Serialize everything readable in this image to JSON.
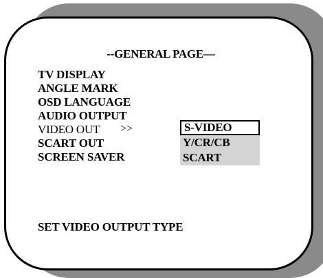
{
  "page": {
    "title": "--GENERAL PAGE—"
  },
  "menu": {
    "items": [
      {
        "label": "TV DISPLAY"
      },
      {
        "label": "ANGLE MARK"
      },
      {
        "label": "OSD LANGUAGE"
      },
      {
        "label": "AUDIO OUTPUT"
      },
      {
        "label": "VIDEO OUT"
      },
      {
        "label": "SCART OUT"
      },
      {
        "label": "SCREEN SAVER"
      }
    ],
    "selected_index": 4,
    "submenu_arrow": ">>"
  },
  "submenu": {
    "options": [
      {
        "label": "S-VIDEO"
      },
      {
        "label": "Y/CR/CB"
      },
      {
        "label": "SCART"
      }
    ],
    "active_index": 0
  },
  "status": {
    "hint": "SET VIDEO OUTPUT TYPE"
  },
  "colors": {
    "frame": "#000000",
    "shadow": "#8a8a8a",
    "option_bg": "#d4d4d4",
    "background": "#ffffff"
  }
}
